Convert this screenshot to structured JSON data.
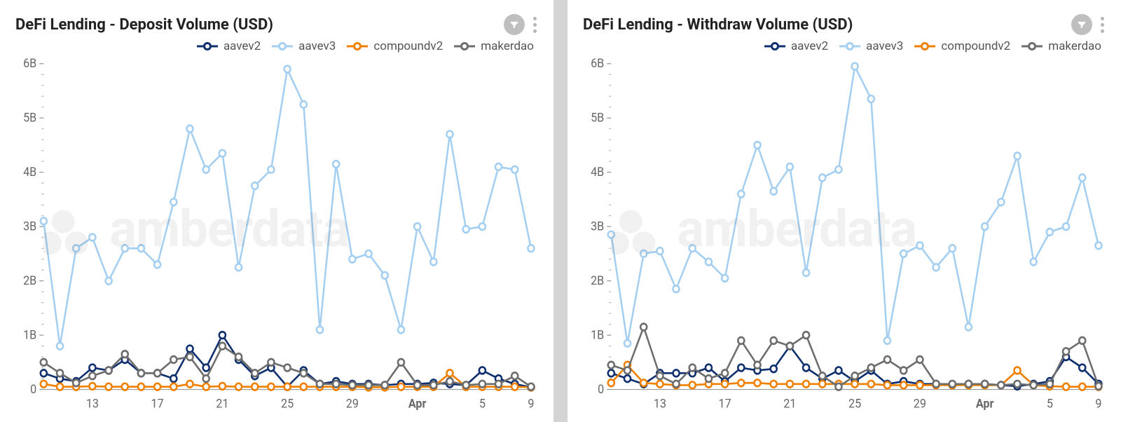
{
  "panels": [
    {
      "title": "DeFi Lending - Deposit Volume (USD)",
      "chart_key": 0
    },
    {
      "title": "DeFi Lending - Withdraw Volume (USD)",
      "chart_key": 1
    }
  ],
  "legend": [
    {
      "name": "aavev2",
      "color": "#0f2f6e"
    },
    {
      "name": "aavev3",
      "color": "#a4cff0"
    },
    {
      "name": "compoundv2",
      "color": "#f08000"
    },
    {
      "name": "makerdao",
      "color": "#6d6d6d"
    }
  ],
  "watermark": "amberdata",
  "chart_data": [
    {
      "type": "line",
      "title": "DeFi Lending - Deposit Volume (USD)",
      "xlabel": "",
      "ylabel": "",
      "ylim": [
        0,
        6000000000
      ],
      "x_ticks": [
        "13",
        "17",
        "21",
        "25",
        "29",
        "Apr",
        "5",
        "9"
      ],
      "y_ticks": [
        "0",
        "1B",
        "2B",
        "3B",
        "4B",
        "5B",
        "6B"
      ],
      "x": [
        "Mar 10",
        "Mar 11",
        "Mar 12",
        "Mar 13",
        "Mar 14",
        "Mar 15",
        "Mar 16",
        "Mar 17",
        "Mar 18",
        "Mar 19",
        "Mar 20",
        "Mar 21",
        "Mar 22",
        "Mar 23",
        "Mar 24",
        "Mar 25",
        "Mar 26",
        "Mar 27",
        "Mar 28",
        "Mar 29",
        "Mar 30",
        "Mar 31",
        "Apr 1",
        "Apr 2",
        "Apr 3",
        "Apr 4",
        "Apr 5",
        "Apr 6",
        "Apr 7",
        "Apr 8",
        "Apr 9"
      ],
      "series": [
        {
          "name": "aavev2",
          "color": "#0f2f6e",
          "values": [
            0.3,
            0.2,
            0.15,
            0.4,
            0.35,
            0.55,
            0.3,
            0.3,
            0.2,
            0.75,
            0.4,
            1.0,
            0.55,
            0.25,
            0.4,
            0.05,
            0.35,
            0.1,
            0.15,
            0.1,
            0.1,
            0.08,
            0.1,
            0.1,
            0.12,
            0.1,
            0.08,
            0.35,
            0.2,
            0.1,
            0.04
          ]
        },
        {
          "name": "aavev3",
          "color": "#a4cff0",
          "values": [
            3.1,
            0.8,
            2.6,
            2.8,
            2.0,
            2.6,
            2.6,
            2.3,
            3.45,
            4.8,
            4.05,
            4.35,
            2.25,
            3.75,
            4.05,
            5.9,
            5.25,
            1.1,
            4.15,
            2.4,
            2.5,
            2.1,
            1.1,
            3.0,
            2.35,
            4.7,
            2.95,
            3.0,
            4.1,
            4.05,
            2.6
          ]
        },
        {
          "name": "compoundv2",
          "color": "#f08000",
          "values": [
            0.1,
            0.05,
            0.05,
            0.06,
            0.05,
            0.05,
            0.05,
            0.05,
            0.05,
            0.1,
            0.05,
            0.06,
            0.05,
            0.05,
            0.05,
            0.05,
            0.05,
            0.05,
            0.05,
            0.05,
            0.04,
            0.04,
            0.05,
            0.05,
            0.05,
            0.3,
            0.05,
            0.05,
            0.05,
            0.05,
            0.04
          ]
        },
        {
          "name": "makerdao",
          "color": "#6d6d6d",
          "values": [
            0.5,
            0.3,
            0.12,
            0.25,
            0.35,
            0.65,
            0.3,
            0.3,
            0.55,
            0.6,
            0.2,
            0.8,
            0.6,
            0.3,
            0.5,
            0.4,
            0.3,
            0.1,
            0.1,
            0.08,
            0.08,
            0.08,
            0.5,
            0.08,
            0.08,
            0.15,
            0.08,
            0.1,
            0.1,
            0.25,
            0.05
          ]
        }
      ]
    },
    {
      "type": "line",
      "title": "DeFi Lending - Withdraw Volume (USD)",
      "xlabel": "",
      "ylabel": "",
      "ylim": [
        0,
        6000000000
      ],
      "x_ticks": [
        "13",
        "17",
        "21",
        "25",
        "29",
        "Apr",
        "5",
        "9"
      ],
      "y_ticks": [
        "0",
        "1B",
        "2B",
        "3B",
        "4B",
        "5B",
        "6B"
      ],
      "x": [
        "Mar 10",
        "Mar 11",
        "Mar 12",
        "Mar 13",
        "Mar 14",
        "Mar 15",
        "Mar 16",
        "Mar 17",
        "Mar 18",
        "Mar 19",
        "Mar 20",
        "Mar 21",
        "Mar 22",
        "Mar 23",
        "Mar 24",
        "Mar 25",
        "Mar 26",
        "Mar 27",
        "Mar 28",
        "Mar 29",
        "Mar 30",
        "Mar 31",
        "Apr 1",
        "Apr 2",
        "Apr 3",
        "Apr 4",
        "Apr 5",
        "Apr 6",
        "Apr 7",
        "Apr 8",
        "Apr 9"
      ],
      "series": [
        {
          "name": "aavev2",
          "color": "#0f2f6e",
          "values": [
            0.3,
            0.2,
            0.1,
            0.3,
            0.3,
            0.3,
            0.4,
            0.15,
            0.4,
            0.35,
            0.38,
            0.8,
            0.4,
            0.2,
            0.35,
            0.15,
            0.35,
            0.1,
            0.15,
            0.1,
            0.1,
            0.08,
            0.1,
            0.1,
            0.08,
            0.06,
            0.1,
            0.15,
            0.6,
            0.4,
            0.1
          ]
        },
        {
          "name": "aavev3",
          "color": "#a4cff0",
          "values": [
            2.85,
            0.85,
            2.5,
            2.55,
            1.85,
            2.6,
            2.35,
            2.05,
            3.6,
            4.5,
            3.65,
            4.1,
            2.15,
            3.9,
            4.05,
            5.95,
            5.35,
            0.9,
            2.5,
            2.65,
            2.25,
            2.6,
            1.15,
            3.0,
            3.45,
            4.3,
            2.35,
            2.9,
            3.0,
            3.9,
            2.65
          ]
        },
        {
          "name": "compoundv2",
          "color": "#f08000",
          "values": [
            0.12,
            0.45,
            0.12,
            0.1,
            0.08,
            0.08,
            0.1,
            0.1,
            0.12,
            0.12,
            0.1,
            0.1,
            0.1,
            0.1,
            0.1,
            0.1,
            0.1,
            0.08,
            0.08,
            0.08,
            0.08,
            0.08,
            0.08,
            0.08,
            0.08,
            0.35,
            0.08,
            0.06,
            0.05,
            0.05,
            0.05
          ]
        },
        {
          "name": "makerdao",
          "color": "#6d6d6d",
          "values": [
            0.45,
            0.35,
            1.15,
            0.25,
            0.1,
            0.4,
            0.2,
            0.3,
            0.9,
            0.45,
            0.9,
            0.8,
            1.0,
            0.25,
            0.05,
            0.25,
            0.4,
            0.55,
            0.35,
            0.55,
            0.1,
            0.1,
            0.1,
            0.1,
            0.08,
            0.1,
            0.08,
            0.1,
            0.7,
            0.9,
            0.06
          ]
        }
      ]
    }
  ]
}
